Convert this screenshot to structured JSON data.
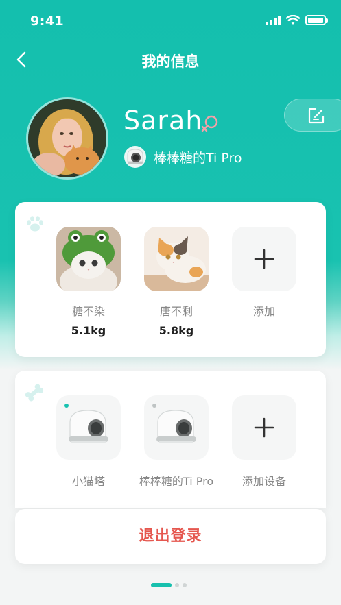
{
  "status_bar": {
    "time": "9:41"
  },
  "header": {
    "title": "我的信息"
  },
  "profile": {
    "name": "Sarah",
    "gender_icon": "female-icon",
    "device_tag": "棒棒糖的Ti Pro"
  },
  "pets": {
    "section_icon": "paw-icon",
    "items": [
      {
        "name": "糖不染",
        "weight": "5.1kg"
      },
      {
        "name": "唐不剩",
        "weight": "5.8kg"
      }
    ],
    "add_label": "添加"
  },
  "devices": {
    "section_icon": "bone-icon",
    "items": [
      {
        "name": "小猫塔",
        "status_color": "#19c2b0"
      },
      {
        "name": "棒棒糖的Ti Pro",
        "status_color": "#bfc4c4"
      }
    ],
    "add_label": "添加设备"
  },
  "logout": {
    "label": "退出登录"
  },
  "pager": {
    "active_index": 0,
    "count": 3
  },
  "colors": {
    "accent": "#19c2b0",
    "danger": "#e5574f"
  }
}
